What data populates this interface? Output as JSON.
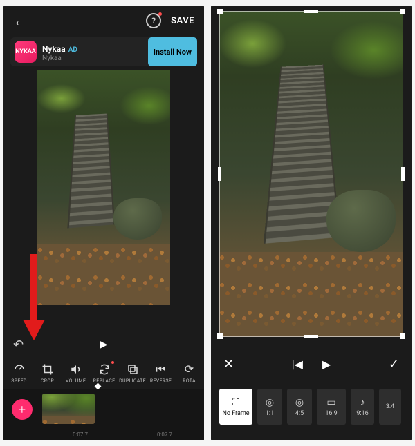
{
  "left": {
    "save": "SAVE",
    "ad": {
      "icon_text": "NYKAA",
      "title": "Nykaa",
      "tag": "AD",
      "subtitle": "Nykaa",
      "cta": "Install Now"
    },
    "tools": [
      {
        "name": "speed",
        "label": "SPEED"
      },
      {
        "name": "crop",
        "label": "CROP"
      },
      {
        "name": "volume",
        "label": "VOLUME"
      },
      {
        "name": "replace",
        "label": "REPLACE"
      },
      {
        "name": "duplicate",
        "label": "DUPLICATE"
      },
      {
        "name": "reverse",
        "label": "REVERSE"
      },
      {
        "name": "rotate",
        "label": "ROTA"
      }
    ],
    "time_left": "0:07.7",
    "time_right": "0:07.7"
  },
  "right": {
    "ratios": [
      {
        "name": "noframe",
        "label": "No Frame"
      },
      {
        "name": "1-1",
        "label": "1:1"
      },
      {
        "name": "4-5",
        "label": "4:5"
      },
      {
        "name": "16-9",
        "label": "16:9"
      },
      {
        "name": "9-16",
        "label": "9:16"
      },
      {
        "name": "3-4",
        "label": "3:4"
      }
    ]
  }
}
